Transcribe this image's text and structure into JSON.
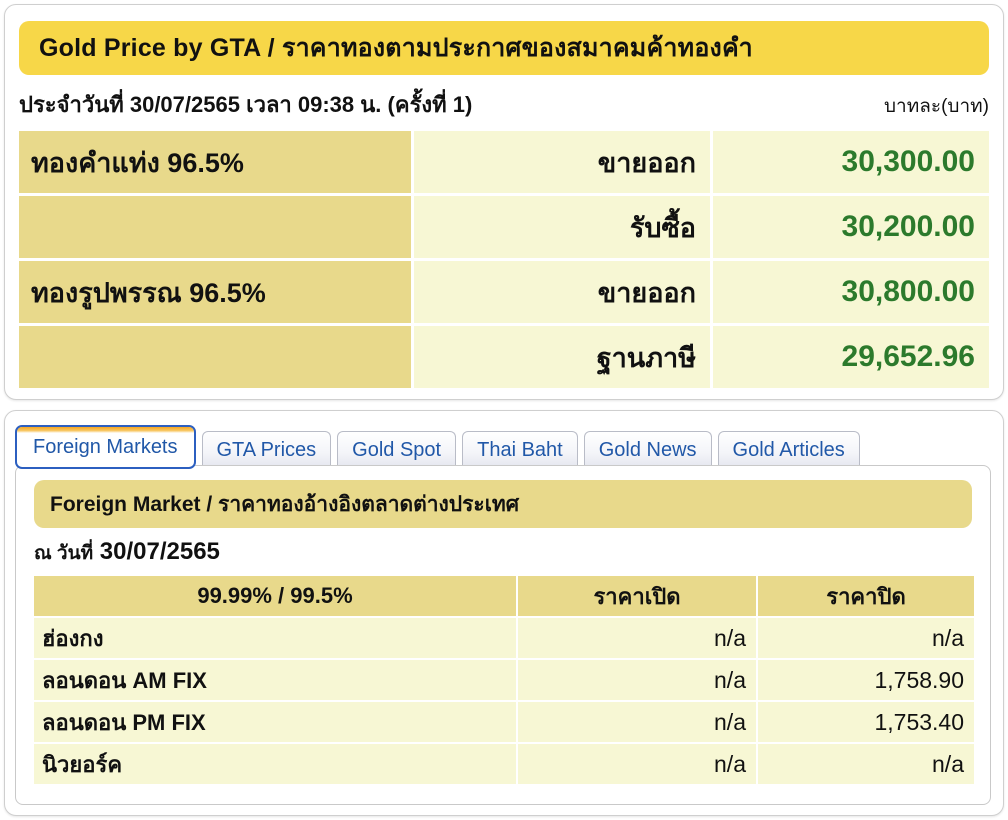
{
  "gta": {
    "banner": {
      "lead_en": "G",
      "rest_en": "OLD ",
      "title_full": "Gold Price by GTA / ราคาทองตามประกาศของสมาคมค้าทองคำ",
      "title_en_part1": "Gold Price by GTA",
      "title_sep": " / ",
      "title_th_part": "ราคาทองตามประกาศของสมาคมค้าทองคำ"
    },
    "date_line": {
      "prefix": "ประจำวันที่",
      "date": "30/07/2565",
      "time_label": "เวลา",
      "time": "09:38",
      "time_unit": "น.",
      "round": "(ครั้งที่ 1)",
      "full": "ประจำวันที่ 30/07/2565 เวลา 09:38 น. (ครั้งที่ 1)",
      "unit_right": "บาทละ(บาท)"
    },
    "rows": [
      {
        "label": "ทองคำแท่ง 96.5%",
        "kind": "ขายออก",
        "value": "30,300.00"
      },
      {
        "label": "",
        "kind": "รับซื้อ",
        "value": "30,200.00"
      },
      {
        "label": "ทองรูปพรรณ 96.5%",
        "kind": "ขายออก",
        "value": "30,800.00"
      },
      {
        "label": "",
        "kind": "ฐานภาษี",
        "value": "29,652.96"
      }
    ]
  },
  "tabs": [
    {
      "label": "Foreign Markets",
      "active": true
    },
    {
      "label": "GTA Prices",
      "active": false
    },
    {
      "label": "Gold Spot",
      "active": false
    },
    {
      "label": "Thai Baht",
      "active": false
    },
    {
      "label": "Gold News",
      "active": false
    },
    {
      "label": "Gold Articles",
      "active": false
    }
  ],
  "foreign": {
    "banner_title": "Foreign Market / ราคาทองอ้างอิงตลาดต่างประเทศ",
    "banner_en": "Foreign Market",
    "banner_sep": " / ",
    "banner_th": "ราคาทองอ้างอิงตลาดต่างประเทศ",
    "date_label": "ณ วันที่",
    "date_value": "30/07/2565",
    "columns": [
      "99.99% / 99.5%",
      "ราคาเปิด",
      "ราคาปิด"
    ],
    "rows": [
      {
        "market": "ฮ่องกง",
        "open": "n/a",
        "close": "n/a"
      },
      {
        "market": "ลอนดอน AM FIX",
        "open": "n/a",
        "close": "1,758.90"
      },
      {
        "market": "ลอนดอน PM FIX",
        "open": "n/a",
        "close": "1,753.40"
      },
      {
        "market": "นิวยอร์ค",
        "open": "n/a",
        "close": "n/a"
      }
    ]
  },
  "colors": {
    "banner_yellow": "#f7d748",
    "banner_gold": "#e8d98b",
    "cell_cream": "#f7f7d4",
    "value_green": "#2c7a2c",
    "tab_blue": "#2158a8",
    "tab_active_border": "#2c5fc0",
    "tab_accent_orange": "#f5a623"
  }
}
